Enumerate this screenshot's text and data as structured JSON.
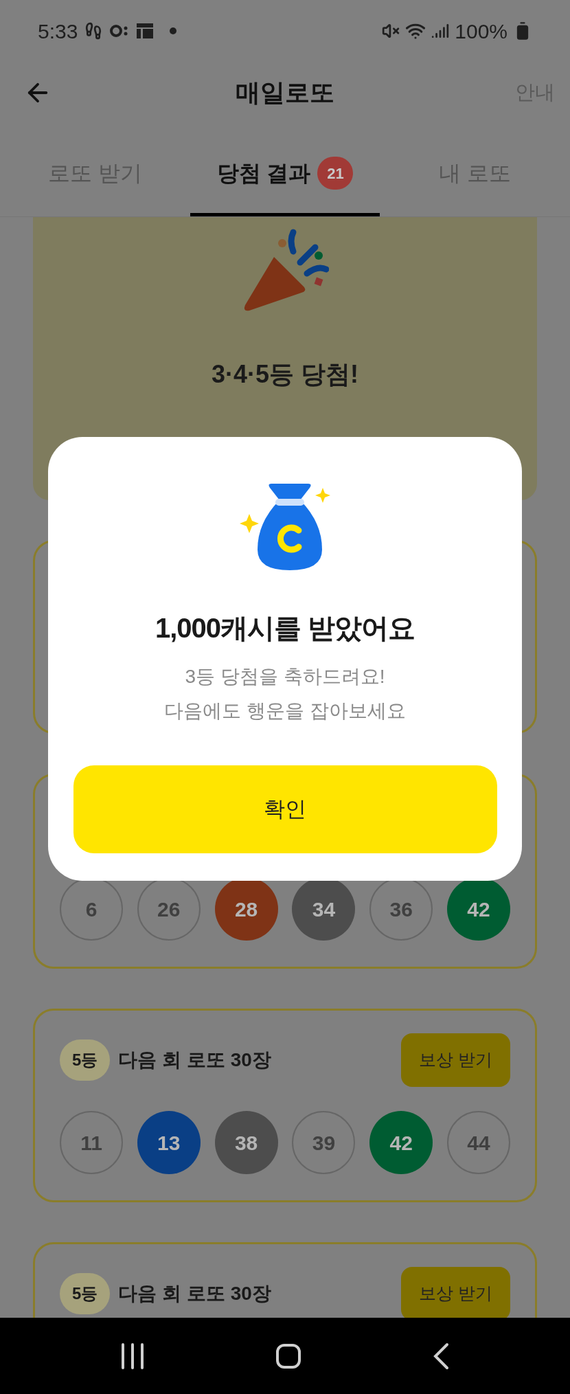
{
  "status_bar": {
    "time": "5:33",
    "battery": "100%"
  },
  "header": {
    "title": "매일로또",
    "action": "안내"
  },
  "tabs": [
    {
      "label": "로또 받기",
      "selected": false
    },
    {
      "label": "당첨 결과",
      "selected": true,
      "badge": "21"
    },
    {
      "label": "내 로또",
      "selected": false
    }
  ],
  "summary": {
    "title": "3·4·5등 당첨!"
  },
  "cards": [
    {
      "balls": [
        {
          "number": "6",
          "kind": "plain"
        },
        {
          "number": "26",
          "kind": "plain"
        },
        {
          "number": "28",
          "kind": "matched",
          "color": "#7f3316"
        },
        {
          "number": "34",
          "kind": "matched",
          "color": "#4d4d4d"
        },
        {
          "number": "36",
          "kind": "plain"
        },
        {
          "number": "42",
          "kind": "matched",
          "color": "#005c32"
        }
      ]
    },
    {
      "rank": "5등",
      "title": "다음 회 로또 30장",
      "button": "보상 받기",
      "balls": [
        {
          "number": "11",
          "kind": "plain"
        },
        {
          "number": "13",
          "kind": "matched",
          "color": "#0a3f85"
        },
        {
          "number": "38",
          "kind": "matched",
          "color": "#4d4d4d"
        },
        {
          "number": "39",
          "kind": "plain"
        },
        {
          "number": "42",
          "kind": "matched",
          "color": "#005c32"
        },
        {
          "number": "44",
          "kind": "plain"
        }
      ]
    },
    {
      "rank": "5등",
      "title": "다음 회 로또 30장",
      "button": "보상 받기"
    }
  ],
  "dialog": {
    "title": "1,000캐시를 받았어요",
    "message": [
      "3등 당첨을 축하드려요!",
      "다음에도 행운을 잡아보세요"
    ],
    "button": "확인"
  }
}
